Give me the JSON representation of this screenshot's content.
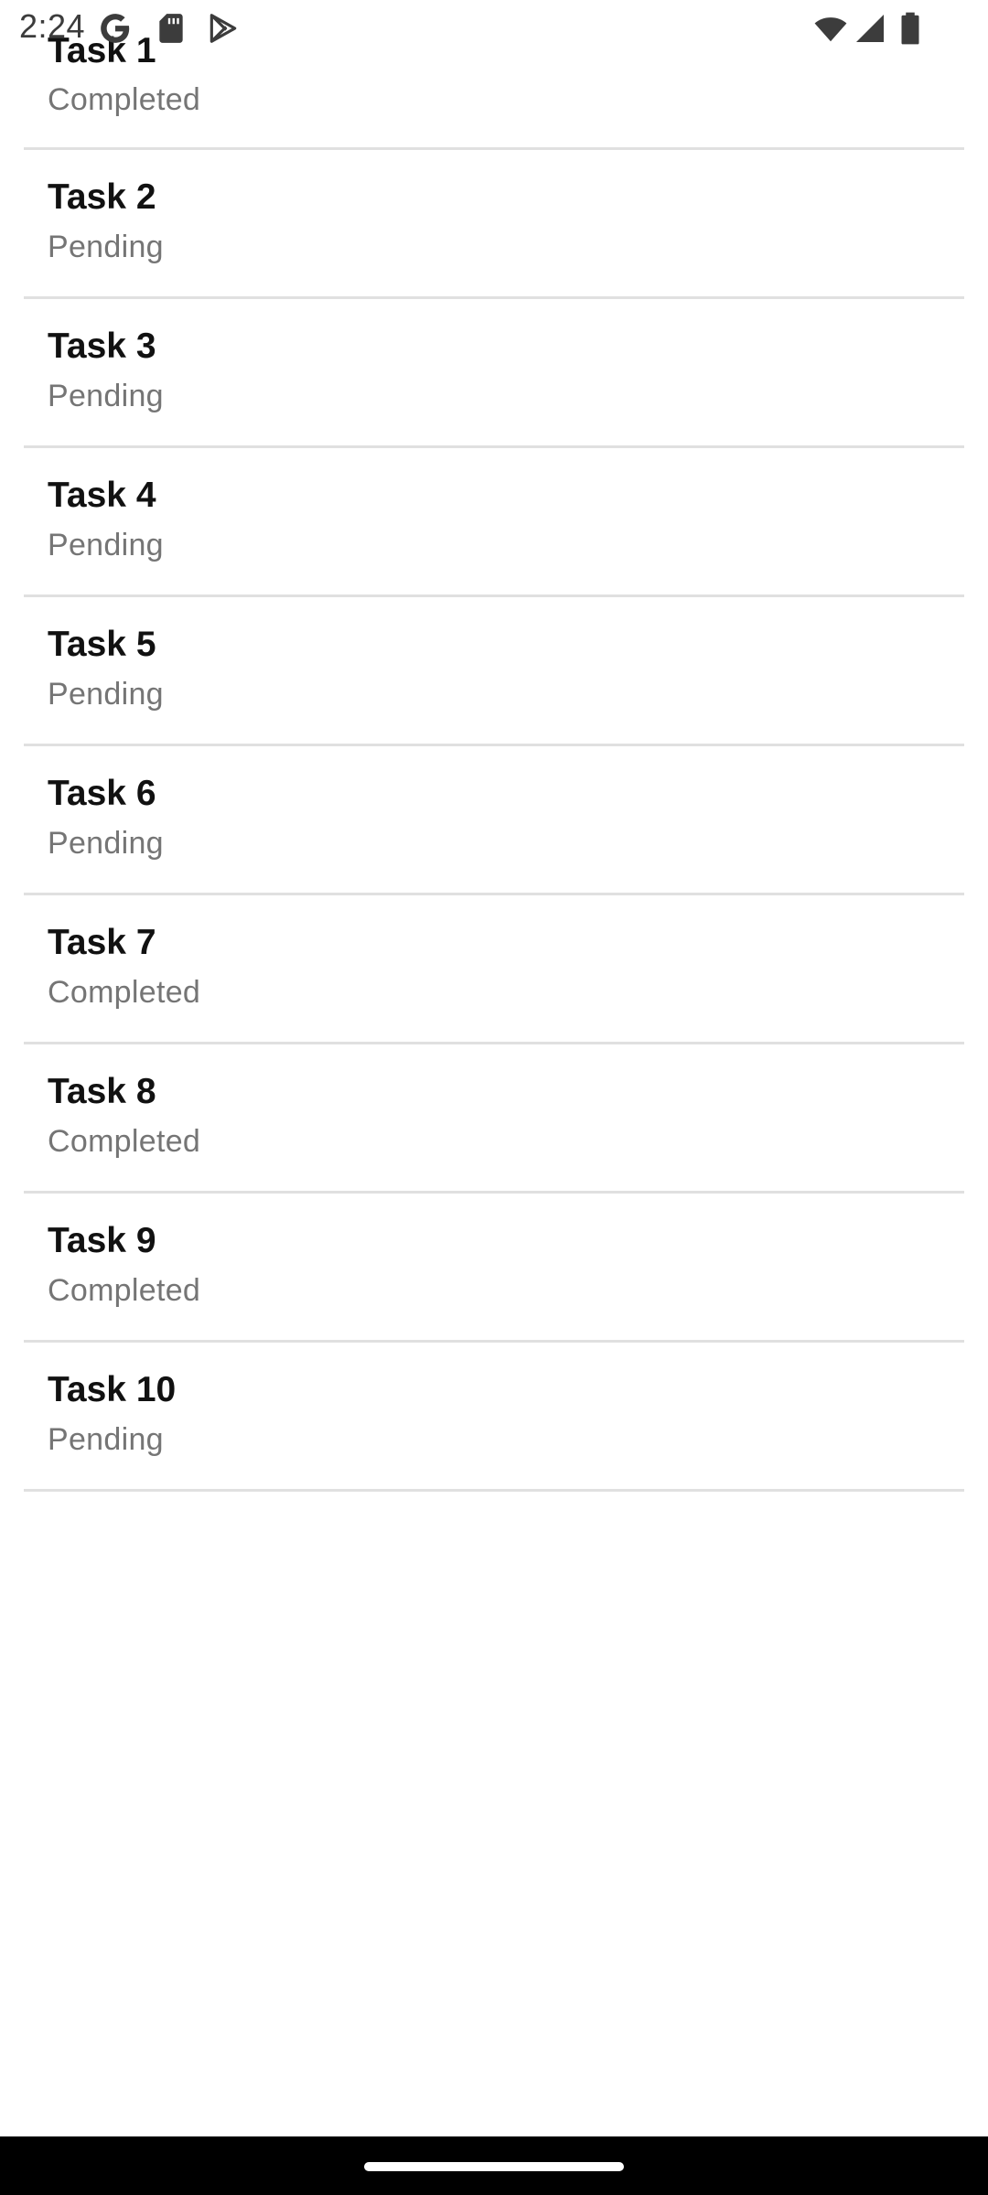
{
  "status_bar": {
    "time": "2:24",
    "icons": [
      "google-icon",
      "sd-card-icon",
      "play-store-icon",
      "wifi-icon",
      "cell-signal-icon",
      "battery-icon"
    ],
    "text_color": "#3c3c3c"
  },
  "tasks": [
    {
      "title": "Task 1",
      "status": "Completed"
    },
    {
      "title": "Task 2",
      "status": "Pending"
    },
    {
      "title": "Task 3",
      "status": "Pending"
    },
    {
      "title": "Task 4",
      "status": "Pending"
    },
    {
      "title": "Task 5",
      "status": "Pending"
    },
    {
      "title": "Task 6",
      "status": "Pending"
    },
    {
      "title": "Task 7",
      "status": "Completed"
    },
    {
      "title": "Task 8",
      "status": "Completed"
    },
    {
      "title": "Task 9",
      "status": "Completed"
    },
    {
      "title": "Task 10",
      "status": "Pending"
    }
  ],
  "colors": {
    "title": "#111111",
    "status": "#757575",
    "divider": "#e0e0e0",
    "nav_bar": "#000000"
  }
}
